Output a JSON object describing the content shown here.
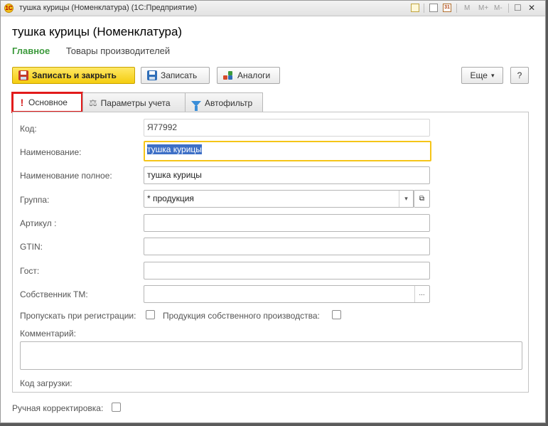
{
  "window": {
    "title": "тушка курицы (Номенклатура)  (1С:Предприятие)",
    "controls": {
      "memory_m": "M",
      "memory_plus": "M+",
      "memory_minus": "M-",
      "restore": "☐",
      "close": "✕"
    }
  },
  "form": {
    "title": "тушка курицы (Номенклатура)",
    "nav": {
      "active": "Главное",
      "link": "Товары производителей"
    }
  },
  "toolbar": {
    "save_close_label": "Записать и закрыть",
    "save_label": "Записать",
    "analogs_label": "Аналоги",
    "more_label": "Еще",
    "more_arrow": "▾",
    "help_label": "?"
  },
  "tabs": [
    {
      "label": "Основное",
      "active": true
    },
    {
      "label": "Параметры учета",
      "active": false
    },
    {
      "label": "Автофильтр",
      "active": false
    }
  ],
  "fields": {
    "code": {
      "label": "Код:",
      "value": "Я77992"
    },
    "name": {
      "label": "Наименование:",
      "value": "тушка курицы"
    },
    "full_name": {
      "label": "Наименование полное:",
      "value": "тушка курицы"
    },
    "group": {
      "label": "Группа:",
      "value": "* продукция",
      "dropdown_glyph": "▾",
      "open_glyph": "⧉"
    },
    "article": {
      "label": "Артикул :",
      "value": ""
    },
    "gtin": {
      "label": "GTIN:",
      "value": ""
    },
    "gost": {
      "label": "Гост:",
      "value": ""
    },
    "owner_tm": {
      "label": "Собственник ТМ:",
      "value": "",
      "select_glyph": "..."
    },
    "skip_registration": {
      "label": "Пропускать при регистрации:",
      "checked": false
    },
    "own_production": {
      "label": "Продукция собственного производства:",
      "checked": false
    },
    "comment": {
      "label": "Комментарий:",
      "value": ""
    },
    "load_code": {
      "label": "Код загрузки:"
    }
  },
  "footer": {
    "manual_correction": {
      "label": "Ручная корректировка:",
      "checked": false
    }
  },
  "colors": {
    "primary_button": "#f4cd0f",
    "active_nav": "#3c9a3c",
    "focus_border": "#f5c518",
    "tab_highlight": "#e21b1b",
    "selection": "#3d6fc6"
  }
}
